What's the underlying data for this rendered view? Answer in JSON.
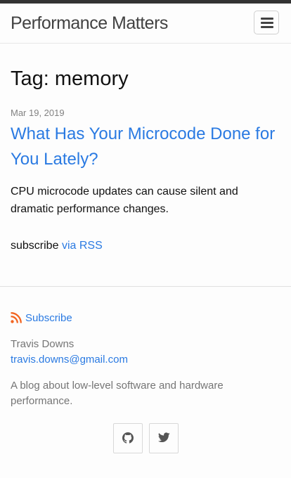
{
  "header": {
    "site_title": "Performance Matters",
    "menu_icon": "hamburger-menu-icon"
  },
  "main": {
    "heading": "Tag: memory",
    "posts": [
      {
        "date": "Mar 19, 2019",
        "title": "What Has Your Microcode Done for You Lately?",
        "excerpt": "CPU microcode updates can cause silent and dramatic performance changes."
      }
    ],
    "subscribe_text": "subscribe",
    "subscribe_link": "via RSS"
  },
  "footer": {
    "subscribe_label": "Subscribe",
    "rss_icon": "rss-icon",
    "author_name": "Travis Downs",
    "email": "travis.downs@gmail.com",
    "description": "A blog about low-level software and hardware performance.",
    "social_icons": [
      "github-icon",
      "twitter-icon"
    ]
  },
  "colors": {
    "link": "#2a7ae2",
    "text": "#111111",
    "muted": "#828282",
    "rss": "#f26522",
    "top_bar": "#333333"
  }
}
